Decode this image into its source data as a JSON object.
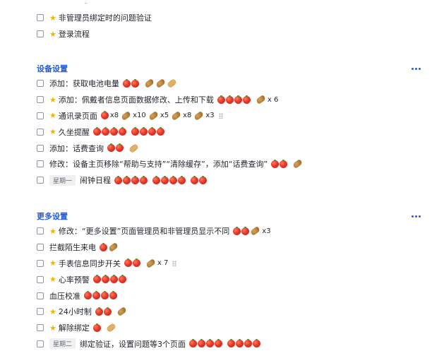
{
  "groups": [
    {
      "title": "",
      "tasks": [
        {
          "starred": true,
          "label": "非管理员绑定时的问题验证",
          "marks": []
        },
        {
          "starred": true,
          "label": "登录流程",
          "marks": []
        }
      ]
    },
    {
      "title": "设备设置",
      "tasks": [
        {
          "starred": false,
          "label": "添加：获取电池电量",
          "marks": [
            "tomato",
            "tomato",
            "gap",
            "potato",
            "potato",
            "peanut"
          ]
        },
        {
          "starred": true,
          "label": "添加：佩戴者信息页面数据修改、上传和下载",
          "marks": [
            "tomato",
            "tomato",
            "tomato",
            "tomato",
            "gap",
            "potato"
          ],
          "multiplier": "x 6"
        },
        {
          "starred": true,
          "label": "通讯录页面",
          "marks": [
            "tomato",
            "x8",
            "potato",
            "x10",
            "potato",
            "x5",
            "potato",
            "x8",
            "potato",
            "x3",
            "handle"
          ]
        },
        {
          "starred": true,
          "label": "久坐提醒",
          "marks": [
            "tomato",
            "tomato",
            "tomato",
            "tomato",
            "gap",
            "tomato",
            "tomato",
            "tomato",
            "tomato"
          ]
        },
        {
          "starred": false,
          "label": "添加：话费查询",
          "marks": [
            "tomato",
            "tomato",
            "gap",
            "peanut"
          ]
        },
        {
          "starred": false,
          "label": "修改：设备主页移除“帮助与支持”“清除缓存”，添加“话费查询”",
          "marks": [
            "tomato",
            "tomato",
            "gap",
            "potato"
          ]
        },
        {
          "starred": false,
          "tag": "星期一",
          "label": "闹钟日程",
          "marks": [
            "tomato",
            "tomato",
            "tomato",
            "tomato",
            "gap",
            "tomato",
            "tomato",
            "tomato",
            "tomato",
            "gap",
            "tomato",
            "tomato"
          ]
        }
      ]
    },
    {
      "title": "更多设置",
      "tasks": [
        {
          "starred": true,
          "label": "修改：“更多设置”页面管理员和非管理员显示不同",
          "marks": [
            "tomato",
            "tomato",
            "potato",
            "x3"
          ]
        },
        {
          "starred": false,
          "label": "拦截陌生来电",
          "marks": [
            "tomato",
            "potato"
          ]
        },
        {
          "starred": true,
          "label": "手表信息同步开关",
          "marks": [
            "tomato",
            "tomato",
            "gap",
            "potato"
          ],
          "multiplier": "x 7",
          "handle": true
        },
        {
          "starred": true,
          "label": "心率预警",
          "marks": [
            "tomato",
            "tomato",
            "tomato",
            "tomato"
          ]
        },
        {
          "starred": false,
          "label": "血压校准",
          "marks": [
            "tomato",
            "tomato",
            "tomato",
            "tomato"
          ]
        },
        {
          "starred": true,
          "label": "24小时制",
          "marks": [
            "tomato",
            "tomato",
            "gap",
            "potato"
          ]
        },
        {
          "starred": true,
          "label": "解除绑定",
          "marks": [
            "tomato",
            "gap",
            "peanut"
          ]
        },
        {
          "starred": false,
          "tag": "星期二",
          "label": "绑定验证，设置问题等3个页面",
          "marks": [
            "tomato",
            "tomato",
            "tomato",
            "tomato",
            "gap",
            "tomato",
            "tomato",
            "tomato",
            "tomato"
          ]
        }
      ]
    }
  ],
  "icons": {
    "star": "star-icon",
    "tomato": "tomato-icon",
    "potato": "potato-icon",
    "peanut": "peanut-icon",
    "more": "more-icon",
    "handle": "drag-handle-icon"
  },
  "colors": {
    "section_title": "#245bdb",
    "star": "#f5b400",
    "tomato": "#e8382a"
  }
}
